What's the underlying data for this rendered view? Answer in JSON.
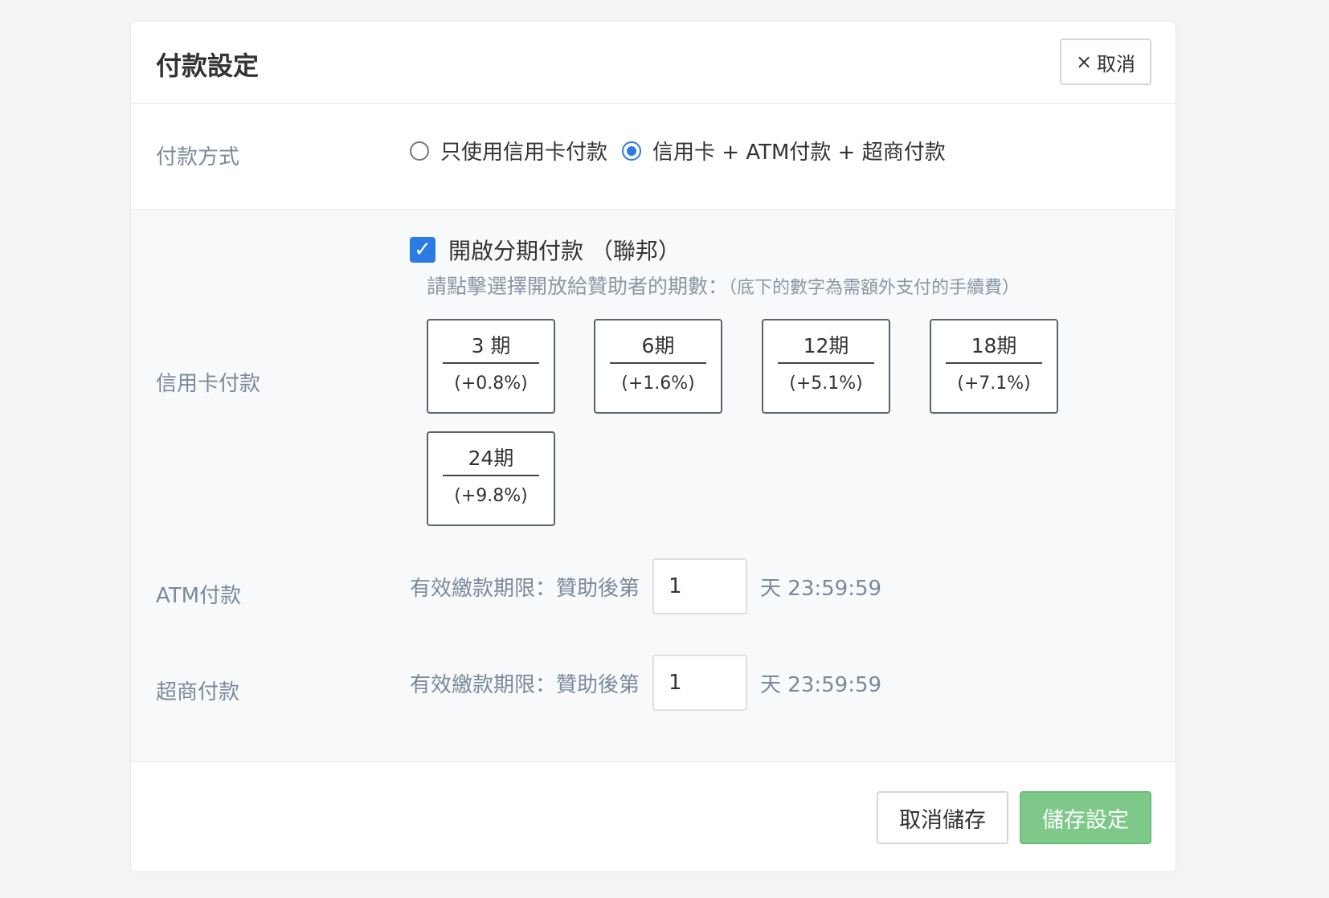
{
  "header": {
    "title": "付款設定",
    "close_label": "取消"
  },
  "payment_method": {
    "label": "付款方式",
    "options": [
      {
        "label": "只使用信用卡付款",
        "selected": false
      },
      {
        "label": "信用卡 + ATM付款 + 超商付款",
        "selected": true
      }
    ]
  },
  "credit_card": {
    "label": "信用卡付款",
    "installment_checkbox_label": "開啟分期付款 （聯邦）",
    "installment_enabled": true,
    "hint_main": "請點擊選擇開放給贊助者的期數：",
    "hint_sub": "（底下的數字為需額外支付的手續費）",
    "tiles": [
      {
        "term": "3 期",
        "fee": "(+0.8%)"
      },
      {
        "term": "6期",
        "fee": "(+1.6%)"
      },
      {
        "term": "12期",
        "fee": "(+5.1%)"
      },
      {
        "term": "18期",
        "fee": "(+7.1%)"
      },
      {
        "term": "24期",
        "fee": "(+9.8%)"
      }
    ]
  },
  "atm": {
    "label": "ATM付款",
    "prefix": "有效繳款期限：贊助後第",
    "days": "1",
    "suffix": "天 23:59:59"
  },
  "cvs": {
    "label": "超商付款",
    "prefix": "有效繳款期限：贊助後第",
    "days": "1",
    "suffix": "天 23:59:59"
  },
  "footer": {
    "cancel_label": "取消儲存",
    "save_label": "儲存設定"
  }
}
